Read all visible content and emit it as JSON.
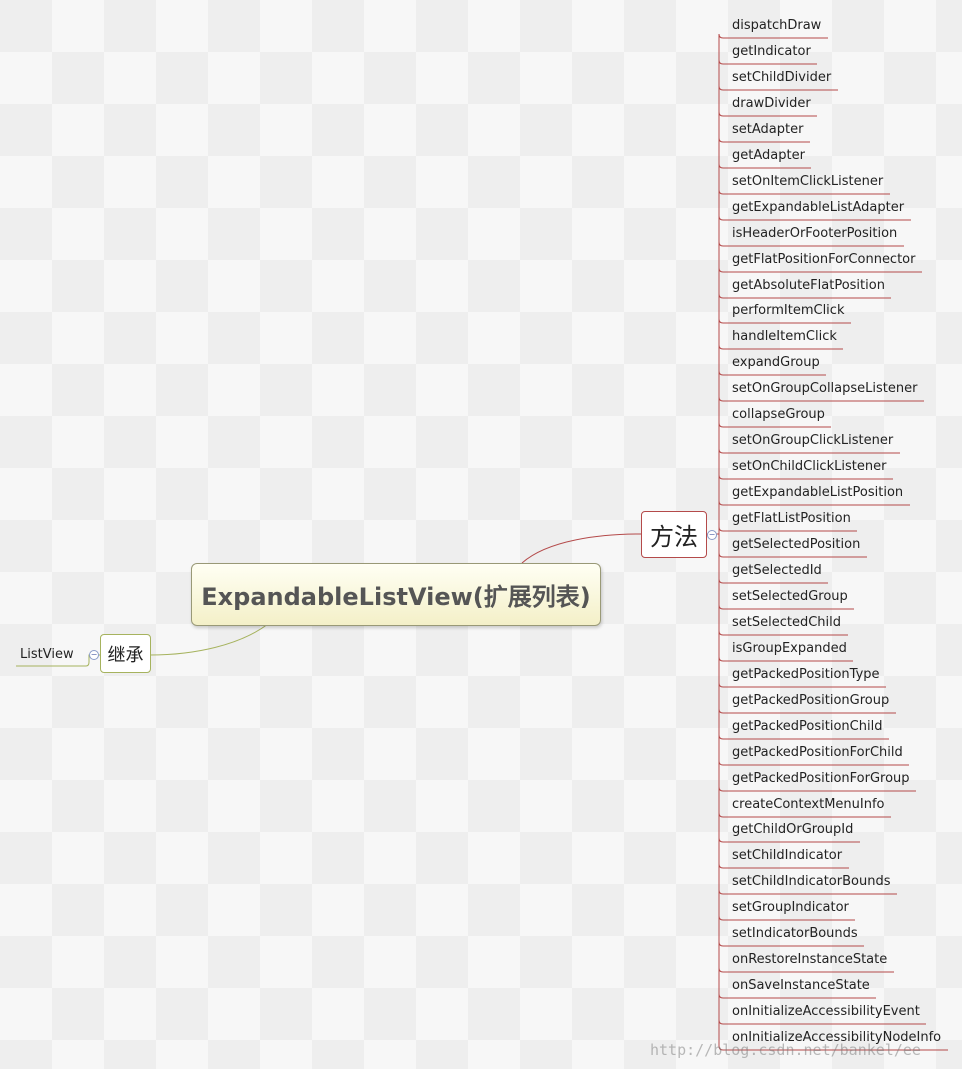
{
  "central_topic": "ExpandableListView(扩展列表)",
  "branches": {
    "methods": {
      "label": "方法",
      "line_color": "#b44a4a",
      "items": [
        "dispatchDraw",
        "getIndicator",
        "setChildDivider",
        "drawDivider",
        "setAdapter",
        "getAdapter",
        "setOnItemClickListener",
        "getExpandableListAdapter",
        "isHeaderOrFooterPosition",
        "getFlatPositionForConnector",
        "getAbsoluteFlatPosition",
        "performItemClick",
        "handleItemClick",
        "expandGroup",
        "setOnGroupCollapseListener",
        "collapseGroup",
        "setOnGroupClickListener",
        "setOnChildClickListener",
        "getExpandableListPosition",
        "getFlatListPosition",
        "getSelectedPosition",
        "getSelectedId",
        "setSelectedGroup",
        "setSelectedChild",
        "isGroupExpanded",
        "getPackedPositionType",
        "getPackedPositionGroup",
        "getPackedPositionChild",
        "getPackedPositionForChild",
        "getPackedPositionForGroup",
        "createContextMenuInfo",
        "getChildOrGroupId",
        "setChildIndicator",
        "setChildIndicatorBounds",
        "setGroupIndicator",
        "setIndicatorBounds",
        "onRestoreInstanceState",
        "onSaveInstanceState",
        "onInitializeAccessibilityEvent",
        "onInitializeAccessibilityNodeInfo"
      ]
    },
    "inherit": {
      "label": "继承",
      "line_color": "#a6b35e",
      "items": [
        "ListView"
      ]
    }
  },
  "watermark": "http://blog.csdn.net/bankel/ee"
}
